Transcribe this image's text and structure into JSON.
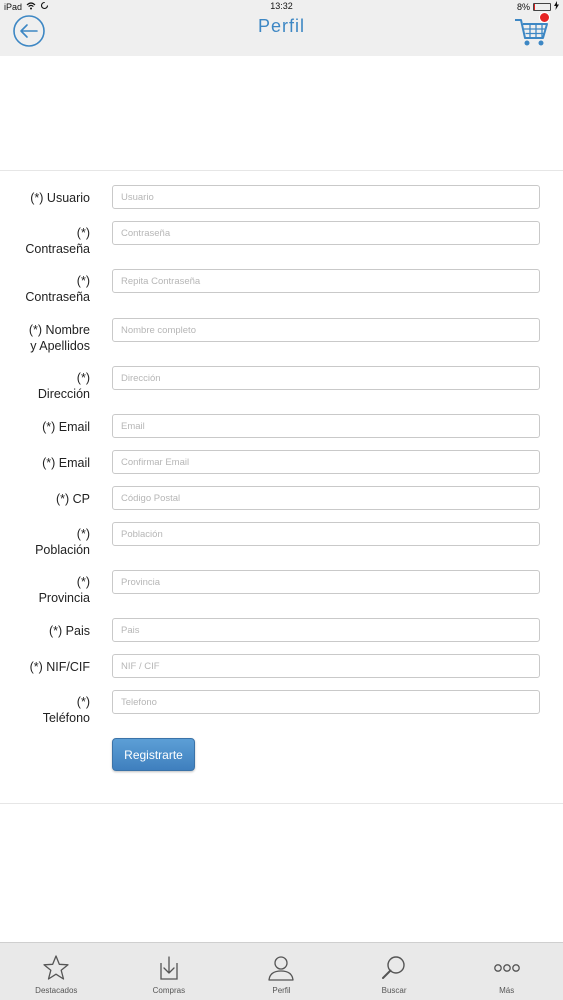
{
  "status_bar": {
    "device": "iPad",
    "time": "13:32",
    "battery": "8%",
    "battery_level": 0.08
  },
  "nav": {
    "title": "Perfil"
  },
  "form": {
    "fields": [
      {
        "label": "(*) Usuario",
        "placeholder": "Usuario"
      },
      {
        "label": "(*)\nContraseña",
        "placeholder": "Contraseña"
      },
      {
        "label": "(*)\nContraseña",
        "placeholder": "Repita Contraseña"
      },
      {
        "label": "(*) Nombre\ny Apellidos",
        "placeholder": "Nombre completo"
      },
      {
        "label": "(*)\nDirección",
        "placeholder": "Dirección"
      },
      {
        "label": "(*) Email",
        "placeholder": "Email"
      },
      {
        "label": "(*) Email",
        "placeholder": "Confirmar Email"
      },
      {
        "label": "(*) CP",
        "placeholder": "Código Postal"
      },
      {
        "label": "(*)\nPoblación",
        "placeholder": "Población"
      },
      {
        "label": "(*)\nProvincia",
        "placeholder": "Provincia"
      },
      {
        "label": "(*) Pais",
        "placeholder": "Pais"
      },
      {
        "label": "(*) NIF/CIF",
        "placeholder": "NIF / CIF"
      },
      {
        "label": "(*)\nTeléfono",
        "placeholder": "Telefono"
      }
    ],
    "submit_label": "Registrarte"
  },
  "tabs": [
    {
      "label": "Destacados",
      "icon": "star-icon"
    },
    {
      "label": "Compras",
      "icon": "download-tray-icon"
    },
    {
      "label": "Perfil",
      "icon": "person-icon"
    },
    {
      "label": "Buscar",
      "icon": "search-icon"
    },
    {
      "label": "Más",
      "icon": "more-dots-icon"
    }
  ],
  "colors": {
    "accent": "#3d87c4",
    "button": "#4a8bc8",
    "badge": "#e62424"
  }
}
